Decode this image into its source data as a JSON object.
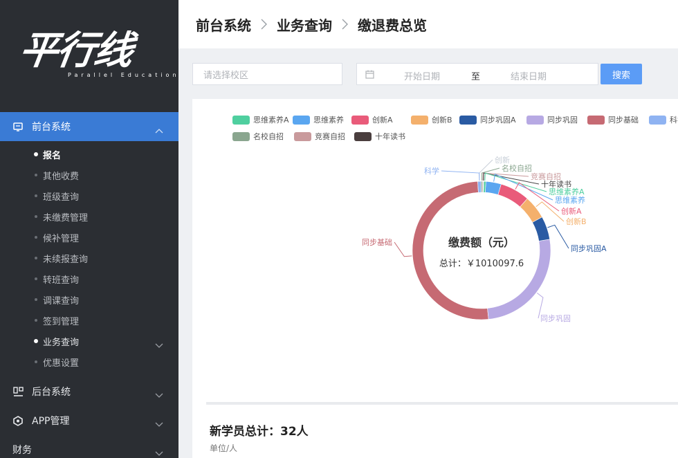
{
  "sidebar": {
    "logo_text": "平行线",
    "logo_sub": "Parallel Education",
    "active_menu": "前台系统",
    "sub_items": [
      "报名",
      "其他收费",
      "班级查询",
      "未缴费管理",
      "候补管理",
      "未续报查询",
      "转班查询",
      "调课查询",
      "签到管理",
      "业务查询",
      "优惠设置"
    ],
    "groups": [
      "后台系统",
      "APP管理",
      "财务"
    ]
  },
  "header": {
    "crumbs": [
      "前台系统",
      "业务查询",
      "缴退费总览"
    ]
  },
  "filter": {
    "school_placeholder": "请选择校区",
    "start_placeholder": "开始日期",
    "range_sep": "至",
    "end_placeholder": "结束日期",
    "search_label": "搜索"
  },
  "chart_data": {
    "type": "pie",
    "title": "缴费额（元）",
    "subtitle": "总计：￥1010097.6",
    "legend": [
      "思维素养A",
      "思维素养",
      "创新A",
      "创新B",
      "同步巩固A",
      "同步巩固",
      "同步基础",
      "科学",
      "名校自招",
      "竞赛自招",
      "十年读书"
    ],
    "legend_position": "top",
    "series": [
      {
        "name": "思维素养A",
        "value": 5000,
        "color": "#4fcf9f"
      },
      {
        "name": "思维素养",
        "value": 36000,
        "color": "#5aa6f0"
      },
      {
        "name": "创新A",
        "value": 70000,
        "color": "#e95b7a"
      },
      {
        "name": "创新B",
        "value": 55000,
        "color": "#f4b06c"
      },
      {
        "name": "同步巩固A",
        "value": 55000,
        "color": "#2a5ba3"
      },
      {
        "name": "同步巩固",
        "value": 262000,
        "color": "#b7a9e3"
      },
      {
        "name": "同步基础",
        "value": 512097.6,
        "color": "#c66a73"
      },
      {
        "name": "科学",
        "value": 8000,
        "color": "#8fb3f2"
      },
      {
        "name": "名校自招",
        "value": 3000,
        "color": "#8aa68f"
      },
      {
        "name": "竞赛自招",
        "value": 2000,
        "color": "#c99a9c"
      },
      {
        "name": "十年读书",
        "value": 1000,
        "color": "#4a3e3e"
      }
    ],
    "extra_labels": [
      "创新"
    ]
  },
  "stats": {
    "title": "新学员总计：32人",
    "unit": "单位/人"
  }
}
